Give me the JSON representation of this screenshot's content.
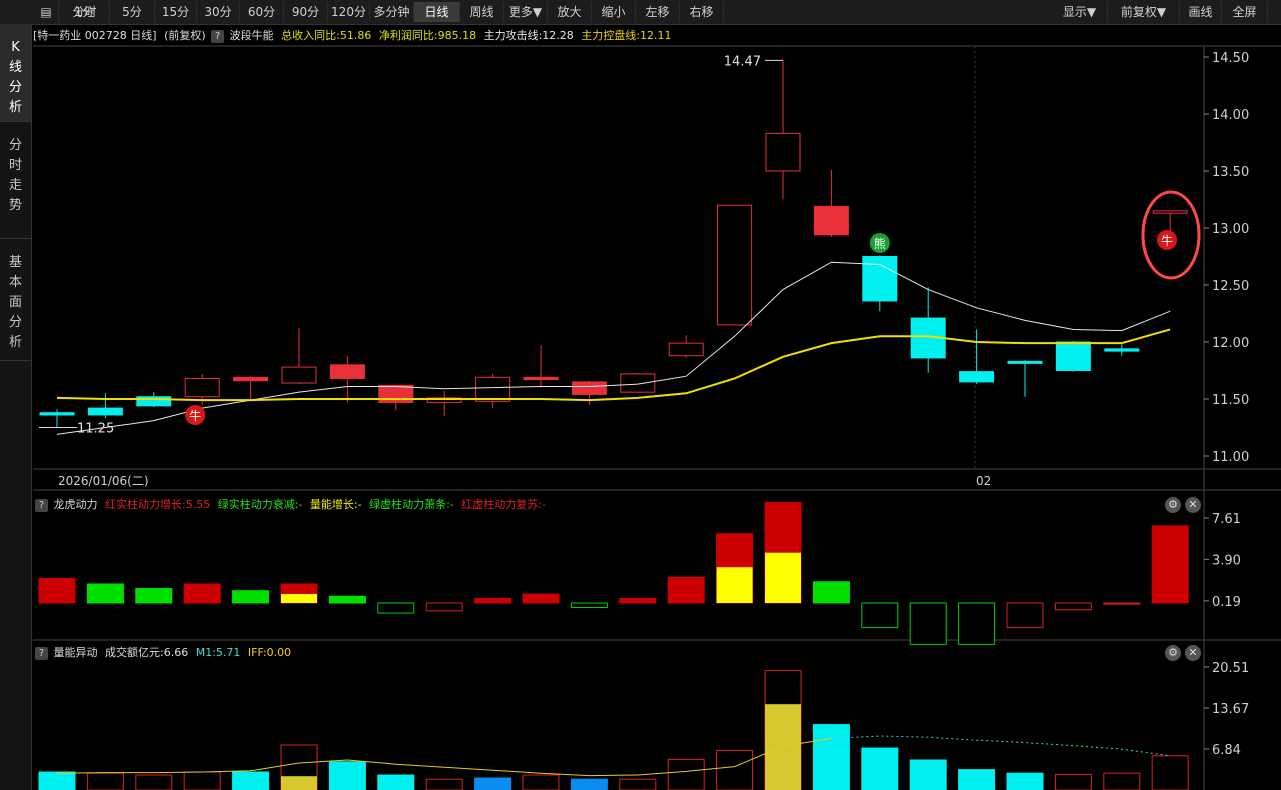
{
  "toolbar": {
    "left": [
      "分时",
      "1分",
      "5分",
      "15分",
      "30分",
      "60分",
      "90分",
      "120分",
      "多分钟",
      "日线",
      "周线",
      "更多▼",
      "放大",
      "缩小",
      "左移",
      "右移"
    ],
    "right": [
      "显示▼",
      "前复权▼",
      "画线",
      "全屏"
    ],
    "active": "日线"
  },
  "sidebar": [
    {
      "chars": [
        "K",
        "线",
        "分",
        "析"
      ],
      "active": true
    },
    {
      "chars": [
        "分",
        "时",
        "走",
        "势"
      ],
      "active": false
    },
    {
      "chars": [
        "基",
        "本",
        "面",
        "分",
        "析"
      ],
      "active": false
    }
  ],
  "header": {
    "stock": "[特一药业 002728 日线]",
    "adj": "(前复权)",
    "indicator": "波段牛能",
    "revenue": "总收入同比:51.86",
    "profit": "净利润同比:985.18",
    "attack": "主力攻击线:12.28",
    "control": "主力控盘线:12.11"
  },
  "main_chart": {
    "yticks": [
      "14.50",
      "14.00",
      "13.50",
      "13.00",
      "12.50",
      "12.00",
      "11.50",
      "11.00"
    ],
    "date_label": "2026/01/06(二)",
    "month_label": "02",
    "high_label": "14.47",
    "low_label": "11.25",
    "signal_bull": "牛",
    "signal_bear": "熊"
  },
  "panel2": {
    "name": "龙虎动力",
    "l1": "红实柱动力增长:5.55",
    "l2": "绿实柱动力衰减:-",
    "l3": "量能增长:-",
    "l4": "绿虚柱动力萧条:-",
    "l5": "红虚柱动力复苏:-",
    "yticks": [
      "7.61",
      "3.90",
      "0.19"
    ]
  },
  "panel3": {
    "name": "量能异动",
    "amount": "成交额亿元:6.66",
    "m1": "M1:5.71",
    "iff": "IFF:0.00",
    "yticks": [
      "20.51",
      "13.67",
      "6.84"
    ]
  },
  "chart_data": {
    "type": "candlestick",
    "candles": [
      {
        "o": 11.38,
        "c": 11.36,
        "h": 11.41,
        "l": 11.25,
        "col": "cyan"
      },
      {
        "o": 11.42,
        "c": 11.36,
        "h": 11.55,
        "l": 11.33,
        "col": "cyan"
      },
      {
        "o": 11.52,
        "c": 11.44,
        "h": 11.56,
        "l": 11.43,
        "col": "cyan"
      },
      {
        "o": 11.52,
        "c": 11.68,
        "h": 11.72,
        "l": 11.45,
        "col": "red"
      },
      {
        "o": 11.66,
        "c": 11.69,
        "h": 11.7,
        "l": 11.49,
        "col": "redfill"
      },
      {
        "o": 11.64,
        "c": 11.78,
        "h": 12.12,
        "l": 11.63,
        "col": "red"
      },
      {
        "o": 11.8,
        "c": 11.68,
        "h": 11.88,
        "l": 11.47,
        "col": "redfill"
      },
      {
        "o": 11.62,
        "c": 11.47,
        "h": 11.62,
        "l": 11.4,
        "col": "redfill"
      },
      {
        "o": 11.51,
        "c": 11.47,
        "h": 11.57,
        "l": 11.35,
        "col": "red"
      },
      {
        "o": 11.48,
        "c": 11.69,
        "h": 11.72,
        "l": 11.42,
        "col": "red"
      },
      {
        "o": 11.67,
        "c": 11.69,
        "h": 11.97,
        "l": 11.6,
        "col": "redfill"
      },
      {
        "o": 11.65,
        "c": 11.54,
        "h": 11.66,
        "l": 11.45,
        "col": "redfill"
      },
      {
        "o": 11.56,
        "c": 11.72,
        "h": 11.73,
        "l": 11.55,
        "col": "red"
      },
      {
        "o": 11.88,
        "c": 11.99,
        "h": 12.06,
        "l": 11.86,
        "col": "red"
      },
      {
        "o": 12.15,
        "c": 13.2,
        "h": 13.2,
        "l": 12.15,
        "col": "red"
      },
      {
        "o": 13.5,
        "c": 13.83,
        "h": 14.47,
        "l": 13.25,
        "col": "red"
      },
      {
        "o": 13.19,
        "c": 12.94,
        "h": 13.51,
        "l": 12.92,
        "col": "redfill"
      },
      {
        "o": 12.75,
        "c": 12.36,
        "h": 12.76,
        "l": 12.27,
        "col": "cyan"
      },
      {
        "o": 12.21,
        "c": 11.86,
        "h": 12.48,
        "l": 11.73,
        "col": "cyan"
      },
      {
        "o": 11.74,
        "c": 11.65,
        "h": 12.11,
        "l": 11.63,
        "col": "cyan"
      },
      {
        "o": 11.83,
        "c": 11.82,
        "h": 11.84,
        "l": 11.52,
        "col": "cyan"
      },
      {
        "o": 12.0,
        "c": 11.75,
        "h": 12.01,
        "l": 11.74,
        "col": "cyan"
      },
      {
        "o": 11.94,
        "c": 11.92,
        "h": 11.98,
        "l": 11.88,
        "col": "cyan"
      },
      {
        "o": 13.15,
        "c": 13.13,
        "h": 13.15,
        "l": 12.9,
        "col": "red"
      }
    ],
    "ma_white": [
      11.19,
      11.25,
      11.31,
      11.42,
      11.49,
      11.56,
      11.61,
      11.61,
      11.59,
      11.6,
      11.61,
      11.61,
      11.63,
      11.7,
      12.05,
      12.46,
      12.7,
      12.68,
      12.46,
      12.3,
      12.19,
      12.11,
      12.1,
      12.27
    ],
    "ma_yellow": [
      11.51,
      11.5,
      11.5,
      11.49,
      11.49,
      11.5,
      11.5,
      11.5,
      11.5,
      11.5,
      11.5,
      11.49,
      11.51,
      11.55,
      11.68,
      11.87,
      11.99,
      12.05,
      12.05,
      12.0,
      11.99,
      11.99,
      11.99,
      12.11
    ],
    "panel2_bars": [
      {
        "v": 2.2,
        "t": "redfill"
      },
      {
        "v": 1.7,
        "t": "greenfill"
      },
      {
        "v": 1.3,
        "t": "greenfill"
      },
      {
        "v": 1.7,
        "t": "redfill"
      },
      {
        "v": 1.1,
        "t": "greenfill"
      },
      {
        "v": 1.7,
        "t": "redfill",
        "y": 0.8
      },
      {
        "v": 0.6,
        "t": "greenfill"
      },
      {
        "v": -0.9,
        "t": "greenhollow"
      },
      {
        "v": -0.7,
        "t": "redhollow"
      },
      {
        "v": 0.4,
        "t": "redfill"
      },
      {
        "v": 0.8,
        "t": "redfill"
      },
      {
        "v": -0.4,
        "t": "greenhollow"
      },
      {
        "v": 0.4,
        "t": "redfill"
      },
      {
        "v": 2.3,
        "t": "redfill"
      },
      {
        "v": 6.2,
        "t": "redfill",
        "y": 3.2
      },
      {
        "v": 9.0,
        "t": "redfill",
        "y": 4.5
      },
      {
        "v": 1.9,
        "t": "greenfill"
      },
      {
        "v": -2.2,
        "t": "greenhollow"
      },
      {
        "v": -3.7,
        "t": "greenhollow"
      },
      {
        "v": -3.7,
        "t": "greenhollow"
      },
      {
        "v": -2.2,
        "t": "redhollow"
      },
      {
        "v": -0.6,
        "t": "redhollow"
      },
      {
        "v": -0.1,
        "t": "redhollow"
      },
      {
        "v": 6.9,
        "t": "redfill"
      }
    ],
    "panel3_bars": [
      {
        "v": 3.0,
        "t": "cyan"
      },
      {
        "v": 2.8,
        "t": "redhollow"
      },
      {
        "v": 2.5,
        "t": "redhollow"
      },
      {
        "v": 3.0,
        "t": "redhollow"
      },
      {
        "v": 3.0,
        "t": "cyan"
      },
      {
        "v": 7.5,
        "t": "redhollow",
        "y": 2.3
      },
      {
        "v": 4.7,
        "t": "cyan"
      },
      {
        "v": 2.5,
        "t": "cyan"
      },
      {
        "v": 1.8,
        "t": "redhollow"
      },
      {
        "v": 2.0,
        "t": "blue"
      },
      {
        "v": 2.5,
        "t": "redhollow"
      },
      {
        "v": 1.8,
        "t": "blue"
      },
      {
        "v": 1.8,
        "t": "redhollow"
      },
      {
        "v": 5.1,
        "t": "redhollow"
      },
      {
        "v": 6.6,
        "t": "redhollow"
      },
      {
        "v": 19.9,
        "t": "redhollow",
        "y": 14.3
      },
      {
        "v": 10.9,
        "t": "cyan"
      },
      {
        "v": 7.0,
        "t": "cyan"
      },
      {
        "v": 5.0,
        "t": "cyan"
      },
      {
        "v": 3.4,
        "t": "cyan"
      },
      {
        "v": 2.8,
        "t": "cyan"
      },
      {
        "v": 2.6,
        "t": "redhollow"
      },
      {
        "v": 2.8,
        "t": "redhollow"
      },
      {
        "v": 5.7,
        "t": "redhollow"
      }
    ],
    "panel3_m1": [
      2.8,
      2.9,
      2.9,
      3.0,
      3.2,
      4.5,
      5.0,
      4.3,
      3.8,
      3.3,
      2.8,
      2.4,
      2.5,
      3.1,
      3.9,
      7.3,
      8.6,
      9.0,
      8.8,
      8.3,
      7.9,
      7.4,
      6.8,
      5.71
    ],
    "ylim_main": [
      11.0,
      14.5
    ],
    "ylim_p2": [
      -3.9,
      7.61
    ],
    "ylim_p3": [
      0,
      20.51
    ]
  }
}
